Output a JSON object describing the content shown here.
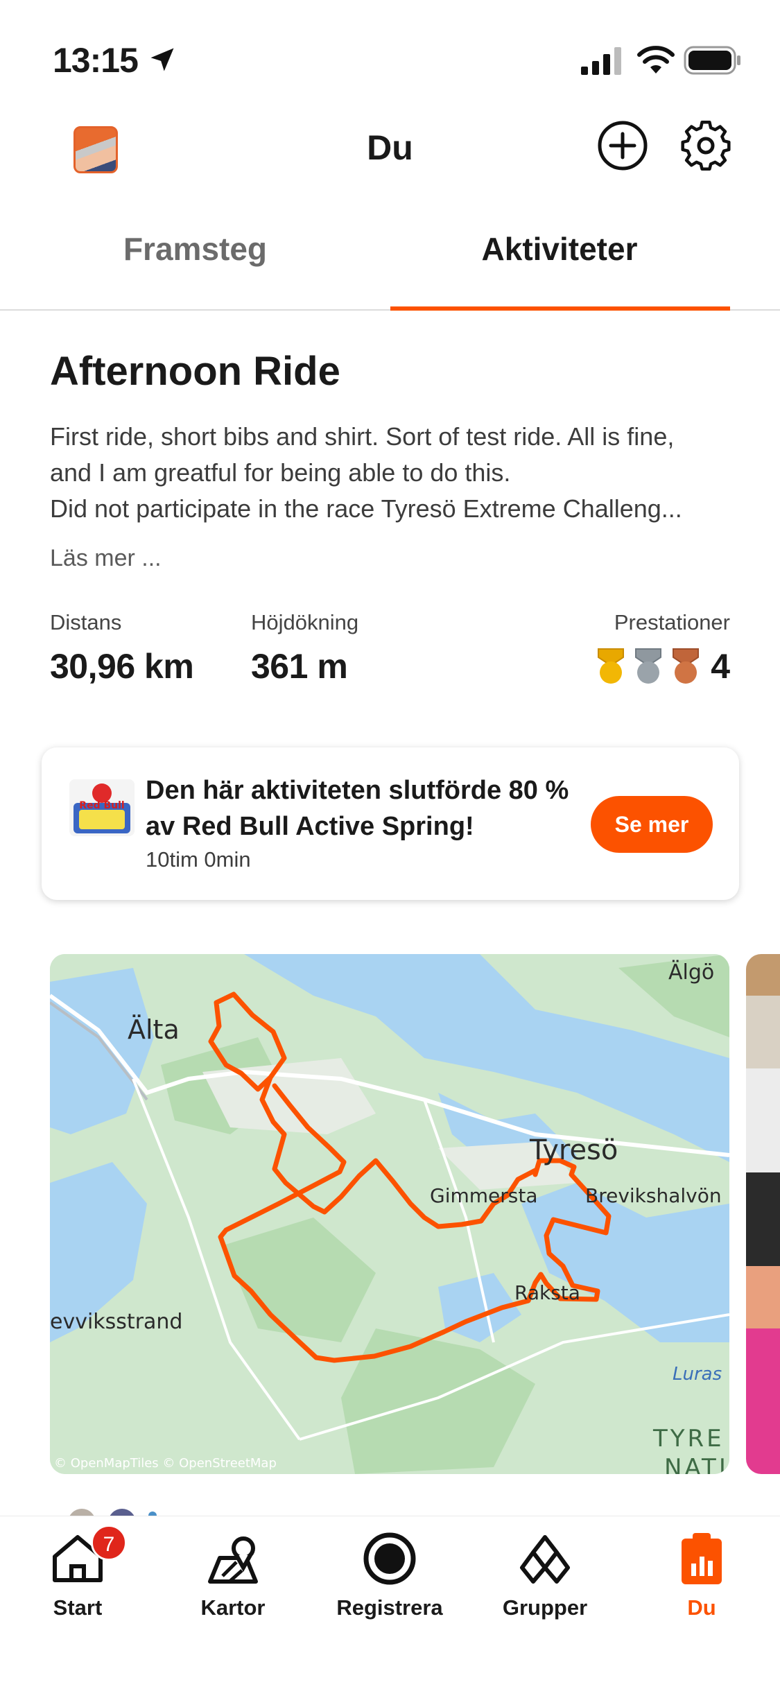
{
  "status_bar": {
    "time": "13:15"
  },
  "header": {
    "title": "Du"
  },
  "tabs": [
    {
      "label": "Framsteg",
      "active": false
    },
    {
      "label": "Aktiviteter",
      "active": true
    }
  ],
  "activity": {
    "title": "Afternoon Ride",
    "description_lines": [
      "First ride, short bibs and shirt. Sort of test ride. All is fine,",
      "and I am greatful for being able to do this.",
      "Did not participate in the race Tyresö Extreme Challeng..."
    ],
    "read_more": "Läs mer ...",
    "stats": {
      "distance": {
        "label": "Distans",
        "value": "30,96 km"
      },
      "elevation": {
        "label": "Höjdökning",
        "value": "361 m"
      },
      "achievements": {
        "label": "Prestationer",
        "count": "4"
      }
    }
  },
  "challenge": {
    "text": "Den här aktiviteten slutförde 80 % av Red Bull Active Spring!",
    "time": "10tim 0min",
    "button": "Se mer",
    "logo_text": "Red Bull"
  },
  "map": {
    "places": {
      "alta": "Älta",
      "algo": "Älgö",
      "tyreso": "Tyresö",
      "gimmersta": "Gimmersta",
      "brevik": "Brevikshalvön",
      "raksta": "Raksta",
      "evviksstrand": "evviksstrand",
      "luras": "Luras",
      "tyre": "TYRE",
      "nati": "NATI"
    },
    "attribution": "© OpenMapTiles © OpenStreetMap"
  },
  "tabbar": {
    "items": [
      {
        "label": "Start",
        "badge": "7"
      },
      {
        "label": "Kartor"
      },
      {
        "label": "Registrera"
      },
      {
        "label": "Grupper"
      },
      {
        "label": "Du",
        "active": true
      }
    ]
  },
  "colors": {
    "accent": "#fc5200",
    "badge": "#e0261b"
  }
}
